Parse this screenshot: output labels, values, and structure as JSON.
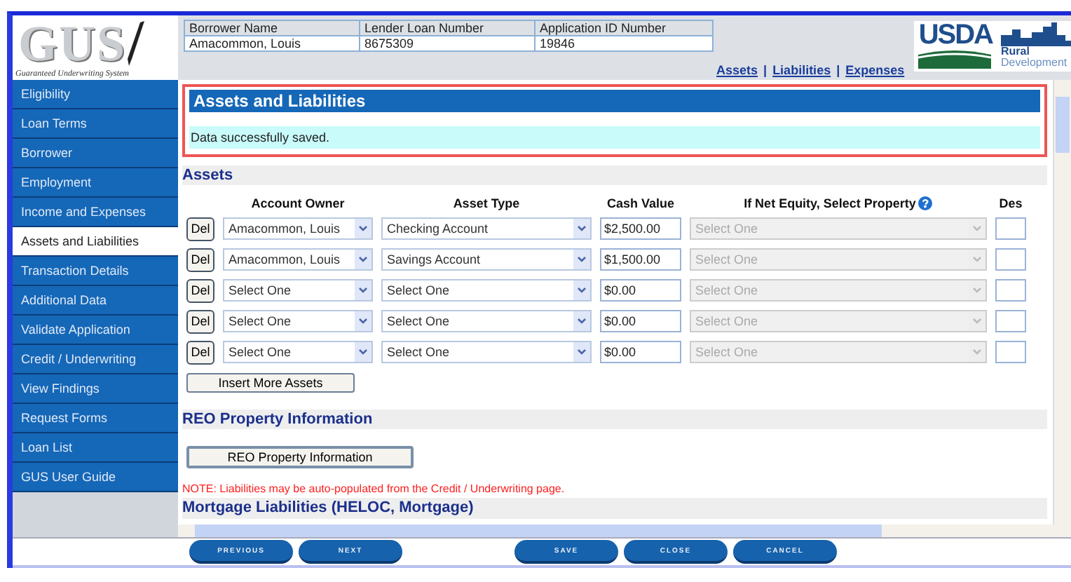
{
  "logo": {
    "title": "GUS",
    "subtitle": "Guaranteed Underwriting System"
  },
  "sidebar": {
    "items": [
      {
        "label": "Eligibility",
        "selected": false
      },
      {
        "label": "Loan Terms",
        "selected": false
      },
      {
        "label": "Borrower",
        "selected": false
      },
      {
        "label": "Employment",
        "selected": false
      },
      {
        "label": "Income and Expenses",
        "selected": false
      },
      {
        "label": "Assets and Liabilities",
        "selected": true
      },
      {
        "label": "Transaction Details",
        "selected": false
      },
      {
        "label": "Additional Data",
        "selected": false
      },
      {
        "label": "Validate Application",
        "selected": false
      },
      {
        "label": "Credit / Underwriting",
        "selected": false
      },
      {
        "label": "View Findings",
        "selected": false
      },
      {
        "label": "Request Forms",
        "selected": false
      },
      {
        "label": "Loan List",
        "selected": false
      },
      {
        "label": "GUS User Guide",
        "selected": false
      }
    ]
  },
  "info_table": {
    "columns": [
      "Borrower Name",
      "Lender Loan Number",
      "Application ID Number"
    ],
    "values": [
      "Amacommon, Louis",
      "8675309",
      "19846"
    ]
  },
  "page_links": [
    {
      "kind": "link",
      "label": "Assets"
    },
    {
      "kind": "separator",
      "label": "|"
    },
    {
      "kind": "link",
      "label": "Liabilities"
    },
    {
      "kind": "separator",
      "label": "|"
    },
    {
      "kind": "link",
      "label": "Expenses"
    }
  ],
  "agency_logo": {
    "name": "USDA",
    "line1": "Rural",
    "line2": "Development"
  },
  "panel": {
    "title": "Assets and Liabilities",
    "message": "Data successfully saved."
  },
  "assets": {
    "heading": "Assets",
    "columns": [
      "Account Owner",
      "Asset Type",
      "Cash Value",
      "If Net Equity, Select Property",
      "Des"
    ],
    "rows": [
      {
        "delete_label": "Del",
        "owner": "Amacommon, Louis",
        "asset_type": "Checking Account",
        "cash_value": "$2,500.00",
        "property": "Select One",
        "property_disabled": true
      },
      {
        "delete_label": "Del",
        "owner": "Amacommon, Louis",
        "asset_type": "Savings Account",
        "cash_value": "$1,500.00",
        "property": "Select One",
        "property_disabled": true
      },
      {
        "delete_label": "Del",
        "owner": "Select One",
        "asset_type": "Select One",
        "cash_value": "$0.00",
        "property": "Select One",
        "property_disabled": true
      },
      {
        "delete_label": "Del",
        "owner": "Select One",
        "asset_type": "Select One",
        "cash_value": "$0.00",
        "property": "Select One",
        "property_disabled": true
      },
      {
        "delete_label": "Del",
        "owner": "Select One",
        "asset_type": "Select One",
        "cash_value": "$0.00",
        "property": "Select One",
        "property_disabled": true
      }
    ],
    "insert_button": "Insert More Assets"
  },
  "reo": {
    "heading": "REO Property Information",
    "button": "REO Property Information"
  },
  "note": "NOTE: Liabilities may be auto-populated from the Credit / Underwriting page.",
  "mortgage_heading": "Mortgage Liabilities (HELOC, Mortgage)",
  "footer_buttons": [
    "PREVIOUS",
    "NEXT",
    "SAVE",
    "CLOSE",
    "CANCEL"
  ]
}
